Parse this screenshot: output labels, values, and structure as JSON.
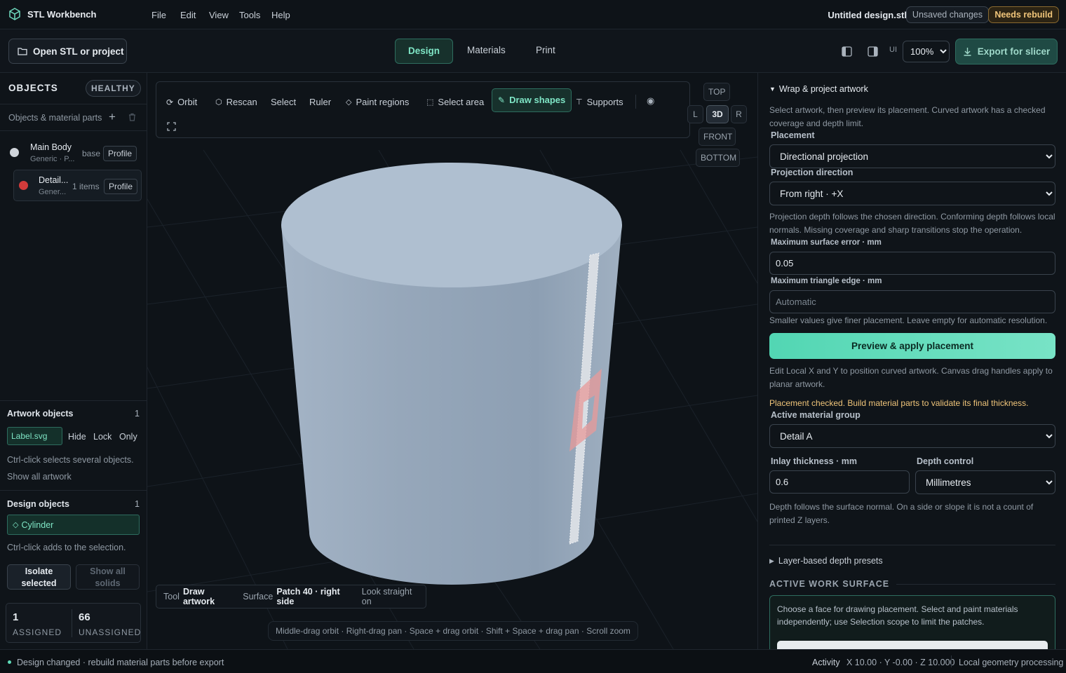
{
  "app": {
    "name": "STL Workbench"
  },
  "menu": [
    "File",
    "Edit",
    "View",
    "Tools",
    "Help"
  ],
  "document": {
    "name": "Untitled design.stl",
    "unsaved": "Unsaved changes",
    "rebuild": "Needs rebuild"
  },
  "toolbar": {
    "open_label": "Open STL or project",
    "tabs": [
      "Design",
      "Materials",
      "Print"
    ],
    "ui_label": "UI",
    "zoom": "100%",
    "export_label": "Export for slicer"
  },
  "left": {
    "objects_title": "OBJECTS",
    "health": "HEALTHY",
    "parts_label": "Objects & material parts",
    "items": [
      {
        "name": "Main Body",
        "sub": "Generic · P...",
        "tag": "base",
        "btn": "Profile",
        "color": "#cfd4da"
      },
      {
        "name": "Detail...",
        "sub": "Gener...",
        "tag": "1 items",
        "btn": "Profile",
        "color": "#d23b3b"
      }
    ],
    "artwork": {
      "title": "Artwork objects",
      "count": "1",
      "chip": "Label.svg",
      "hide": "Hide",
      "lock": "Lock",
      "only": "Only",
      "hint": "Ctrl-click selects several objects.",
      "show_all": "Show all artwork"
    },
    "design": {
      "title": "Design objects",
      "count": "1",
      "chip": "Cylinder",
      "hint": "Ctrl-click adds to the selection.",
      "isolate": "Isolate selected",
      "show_all": "Show all solids"
    },
    "stats": {
      "assigned_num": "1",
      "assigned_label": "ASSIGNED",
      "unassigned_num": "66",
      "unassigned_label": "UNASSIGNED"
    }
  },
  "viewport": {
    "tools": [
      "Orbit",
      "Rescan",
      "Select",
      "Ruler",
      "Paint regions",
      "Select area",
      "Draw shapes",
      "Supports"
    ],
    "views": {
      "top": "TOP",
      "left": "L",
      "threed": "3D",
      "right": "R",
      "front": "FRONT",
      "bottom": "BOTTOM"
    },
    "status": {
      "tool_label": "Tool",
      "tool_value": "Draw artwork",
      "surface_label": "Surface",
      "surface_value": "Patch 40 · right side",
      "look": "Look straight on"
    },
    "hint": "Middle-drag orbit · Right-drag pan · Space + drag orbit · Shift + Space + drag pan · Scroll zoom"
  },
  "right": {
    "section_title": "Wrap & project artwork",
    "intro": "Select artwork, then preview its placement. Curved artwork has a checked coverage and depth limit.",
    "placement_label": "Placement",
    "placement_value": "Directional projection",
    "direction_label": "Projection direction",
    "direction_value": "From right · +X",
    "depth_note": "Projection depth follows the chosen direction. Conforming depth follows local normals. Missing coverage and sharp transitions stop the operation.",
    "max_error_label": "Maximum surface error · mm",
    "max_error_value": "0.05",
    "max_edge_label": "Maximum triangle edge · mm",
    "max_edge_placeholder": "Automatic",
    "edge_note": "Smaller values give finer placement. Leave empty for automatic resolution.",
    "preview_btn": "Preview & apply placement",
    "edit_note": "Edit Local X and Y to position curved artwork. Canvas drag handles apply to planar artwork.",
    "warning": "Placement checked. Build material parts to validate its final thickness.",
    "group_label": "Active material group",
    "group_value": "Detail A",
    "inlay_label": "Inlay thickness · mm",
    "inlay_value": "0.6",
    "depthctl_label": "Depth control",
    "depthctl_value": "Millimetres",
    "normal_note": "Depth follows the surface normal. On a side or slope it is not a count of printed Z layers.",
    "presets": "Layer-based depth presets",
    "work_surface_title": "ACTIVE WORK SURFACE",
    "work_surface_text": "Choose a face for drawing placement. Select and paint materials independently; use Selection scope to limit the patches."
  },
  "statusbar": {
    "message": "Design changed · rebuild material parts before export",
    "activity": "Activity",
    "coords": "X 10.00 · Y -0.00 · Z 10.000",
    "processing": "Local geometry processing"
  },
  "colors": {
    "accent": "#5fdcb9",
    "warning": "#f0c57a",
    "model": "#a9b9cb"
  }
}
